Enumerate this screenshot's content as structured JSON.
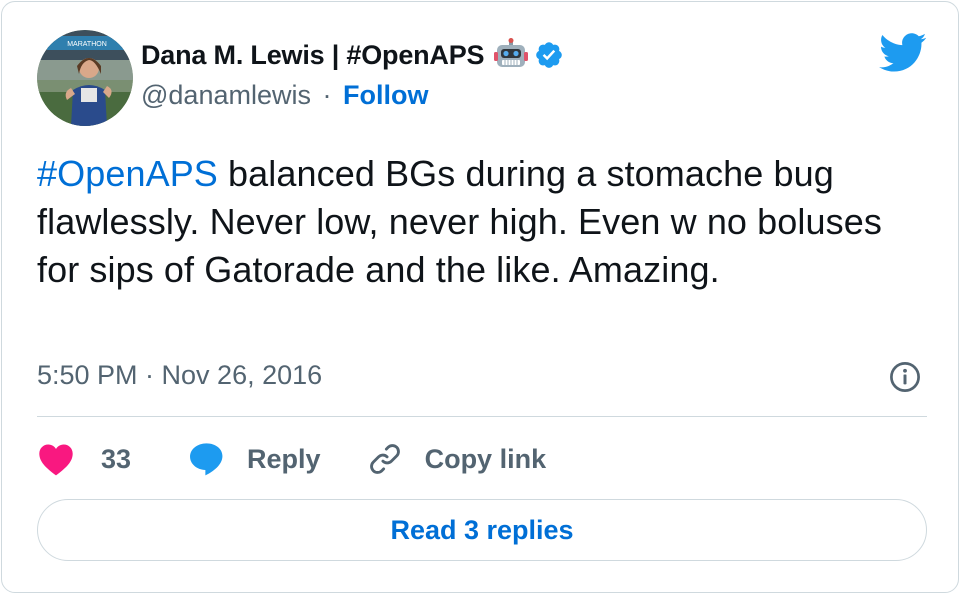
{
  "author": {
    "display_name": "Dana M. Lewis | #OpenAPS",
    "handle": "@danamlewis",
    "separator": "·",
    "follow_label": "Follow"
  },
  "avatar": {
    "banner_text": "MARATHON"
  },
  "tweet": {
    "hashtag": "#OpenAPS",
    "text": " balanced BGs during a stomache bug flawlessly. Never low, never high. Even w no boluses for sips of Gatorade and the like. Amazing.",
    "timestamp": "5:50 PM · Nov 26, 2016"
  },
  "actions": {
    "like_count": "33",
    "reply_label": "Reply",
    "copy_link_label": "Copy link"
  },
  "read_replies_label": "Read 3 replies",
  "colors": {
    "link_blue": "#006fd6",
    "twitter_blue": "#1d9bf0",
    "like_pink": "#f91880",
    "secondary_text": "#536471",
    "border": "#cfd9de"
  }
}
